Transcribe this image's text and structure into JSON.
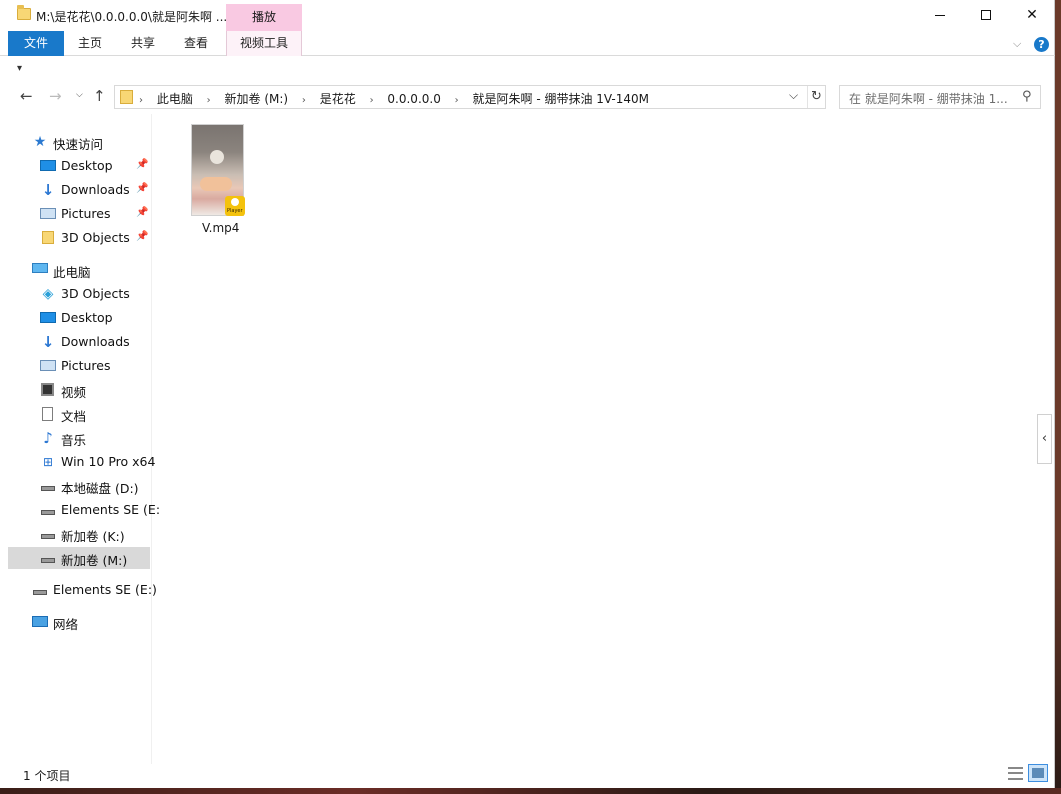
{
  "window": {
    "title": "M:\\是花花\\0.0.0.0.0\\就是阿朱啊 ...",
    "context_tab_header": "播放"
  },
  "ribbon": {
    "tabs": [
      {
        "label": "文件"
      },
      {
        "label": "主页"
      },
      {
        "label": "共享"
      },
      {
        "label": "查看"
      },
      {
        "label": "视频工具"
      }
    ]
  },
  "address": {
    "crumbs": [
      "此电脑",
      "新加卷 (M:)",
      "是花花",
      "0.0.0.0.0",
      "就是阿朱啊 - 绷带抹油  1V-140M"
    ],
    "search_placeholder": "在 就是阿朱啊 - 绷带抹油  1..."
  },
  "navpane": {
    "quick_access": {
      "label": "快速访问"
    },
    "quick_items": [
      {
        "label": "Desktop",
        "icon": "desktop-icon",
        "pinned": true
      },
      {
        "label": "Downloads",
        "icon": "download-icon",
        "pinned": true
      },
      {
        "label": "Pictures",
        "icon": "pictures-icon",
        "pinned": true
      },
      {
        "label": "3D Objects",
        "icon": "folder-icon",
        "pinned": true
      }
    ],
    "this_pc": {
      "label": "此电脑"
    },
    "pc_items": [
      {
        "label": "3D Objects",
        "icon": "3d-objects-icon"
      },
      {
        "label": "Desktop",
        "icon": "desktop-icon"
      },
      {
        "label": "Downloads",
        "icon": "download-icon"
      },
      {
        "label": "Pictures",
        "icon": "pictures-icon"
      },
      {
        "label": "视频",
        "icon": "video-icon"
      },
      {
        "label": "文档",
        "icon": "document-icon"
      },
      {
        "label": "音乐",
        "icon": "music-icon"
      },
      {
        "label": "Win 10 Pro x64",
        "icon": "windows-drive-icon"
      },
      {
        "label": "本地磁盘 (D:)",
        "icon": "drive-icon"
      },
      {
        "label": "Elements SE (E:",
        "icon": "drive-icon"
      },
      {
        "label": "新加卷 (K:)",
        "icon": "drive-icon"
      },
      {
        "label": "新加卷 (M:)",
        "icon": "drive-icon",
        "selected": true
      }
    ],
    "elements": {
      "label": "Elements SE (E:)"
    },
    "network": {
      "label": "网络"
    }
  },
  "files": [
    {
      "name": "V.mp4",
      "badge": "Player"
    }
  ],
  "status": {
    "count": "1 个项目"
  }
}
